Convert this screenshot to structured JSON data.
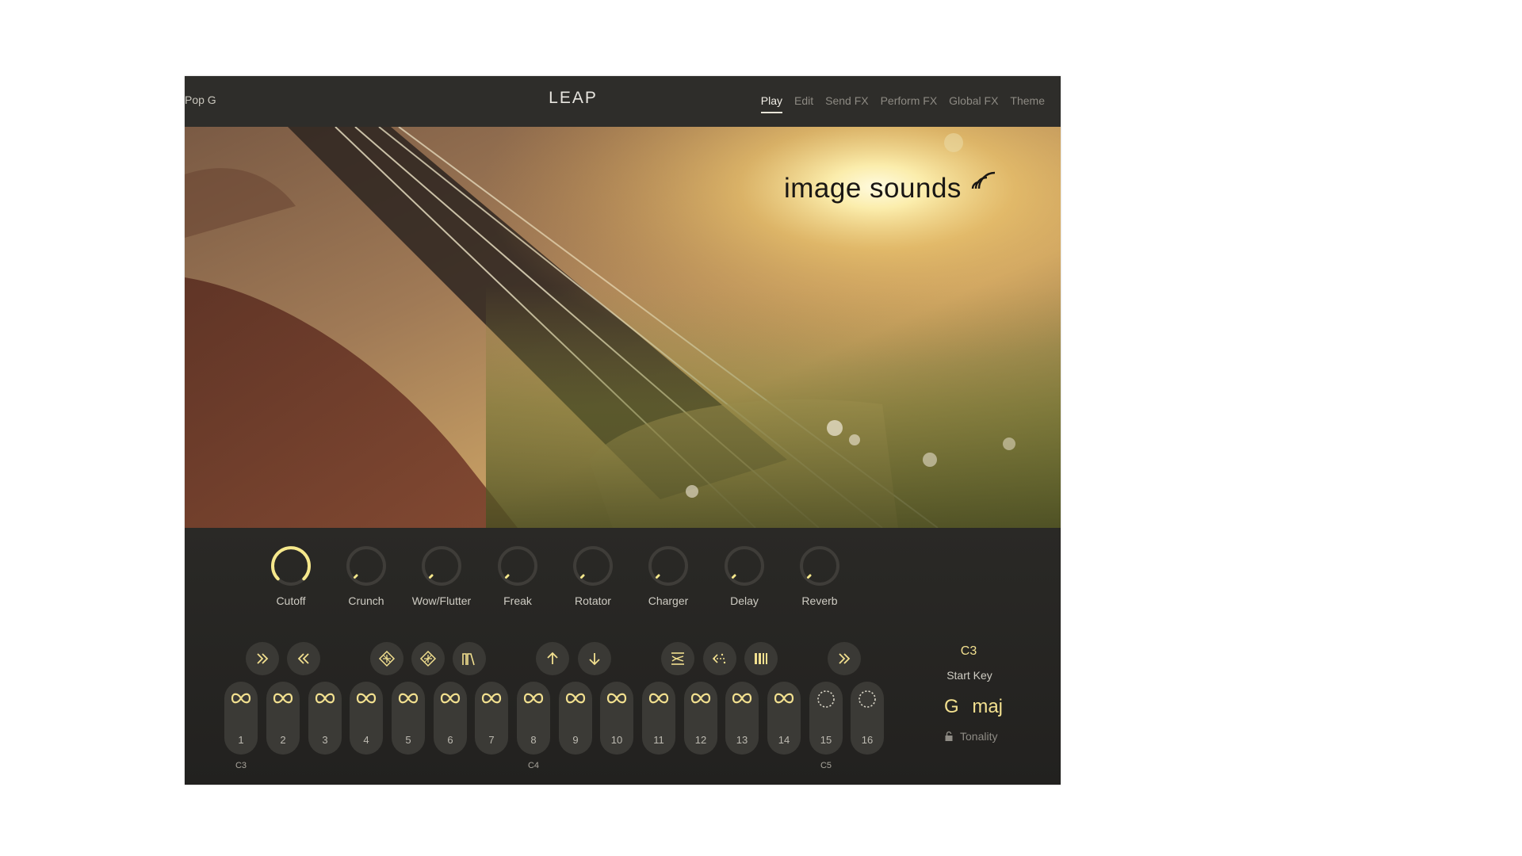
{
  "header": {
    "preset_name": "Pop G",
    "logo": "LEAP",
    "tabs": [
      {
        "label": "Play",
        "active": true
      },
      {
        "label": "Edit",
        "active": false
      },
      {
        "label": "Send FX",
        "active": false
      },
      {
        "label": "Perform FX",
        "active": false
      },
      {
        "label": "Global FX",
        "active": false
      },
      {
        "label": "Theme",
        "active": false
      }
    ]
  },
  "hero": {
    "brand": "image sounds",
    "brand_icon": "signal-waves-icon"
  },
  "knobs": [
    {
      "label": "Cutoff",
      "value": 0.98
    },
    {
      "label": "Crunch",
      "value": 0
    },
    {
      "label": "Wow/Flutter",
      "value": 0
    },
    {
      "label": "Freak",
      "value": 0
    },
    {
      "label": "Rotator",
      "value": 0
    },
    {
      "label": "Charger",
      "value": 0
    },
    {
      "label": "Delay",
      "value": 0
    },
    {
      "label": "Reverb",
      "value": 0
    }
  ],
  "transport_buttons": [
    {
      "icon": "double-chevron-right-icon"
    },
    {
      "icon": "double-chevron-left-icon"
    },
    {
      "icon": "diamond-pattern-icon"
    },
    {
      "icon": "diamond-pattern-alt-icon"
    },
    {
      "icon": "waveform-icon"
    },
    {
      "icon": "arrow-up-icon"
    },
    {
      "icon": "arrow-down-icon"
    },
    {
      "icon": "swap-arrows-icon"
    },
    {
      "icon": "scatter-arrow-icon"
    },
    {
      "icon": "bars-icon"
    },
    {
      "icon": "double-chevron-right-icon"
    }
  ],
  "pads": [
    {
      "number": "1",
      "icon": "infinity-icon"
    },
    {
      "number": "2",
      "icon": "infinity-icon"
    },
    {
      "number": "3",
      "icon": "infinity-icon"
    },
    {
      "number": "4",
      "icon": "infinity-icon"
    },
    {
      "number": "5",
      "icon": "infinity-icon"
    },
    {
      "number": "6",
      "icon": "infinity-icon"
    },
    {
      "number": "7",
      "icon": "infinity-icon"
    },
    {
      "number": "8",
      "icon": "infinity-icon"
    },
    {
      "number": "9",
      "icon": "infinity-icon"
    },
    {
      "number": "10",
      "icon": "infinity-icon"
    },
    {
      "number": "11",
      "icon": "infinity-icon"
    },
    {
      "number": "12",
      "icon": "infinity-icon"
    },
    {
      "number": "13",
      "icon": "infinity-icon"
    },
    {
      "number": "14",
      "icon": "infinity-icon"
    },
    {
      "number": "15",
      "icon": "dotted-circle-icon"
    },
    {
      "number": "16",
      "icon": "dotted-circle-icon"
    }
  ],
  "note_labels": [
    "C3",
    "C4",
    "C5"
  ],
  "start_key": {
    "value": "C3",
    "label": "Start Key"
  },
  "tonality": {
    "root": "G",
    "mode": "maj",
    "label": "Tonality"
  },
  "colors": {
    "accent": "#f2e08f",
    "panel": "#262522",
    "topbar": "#2e2d2a"
  }
}
